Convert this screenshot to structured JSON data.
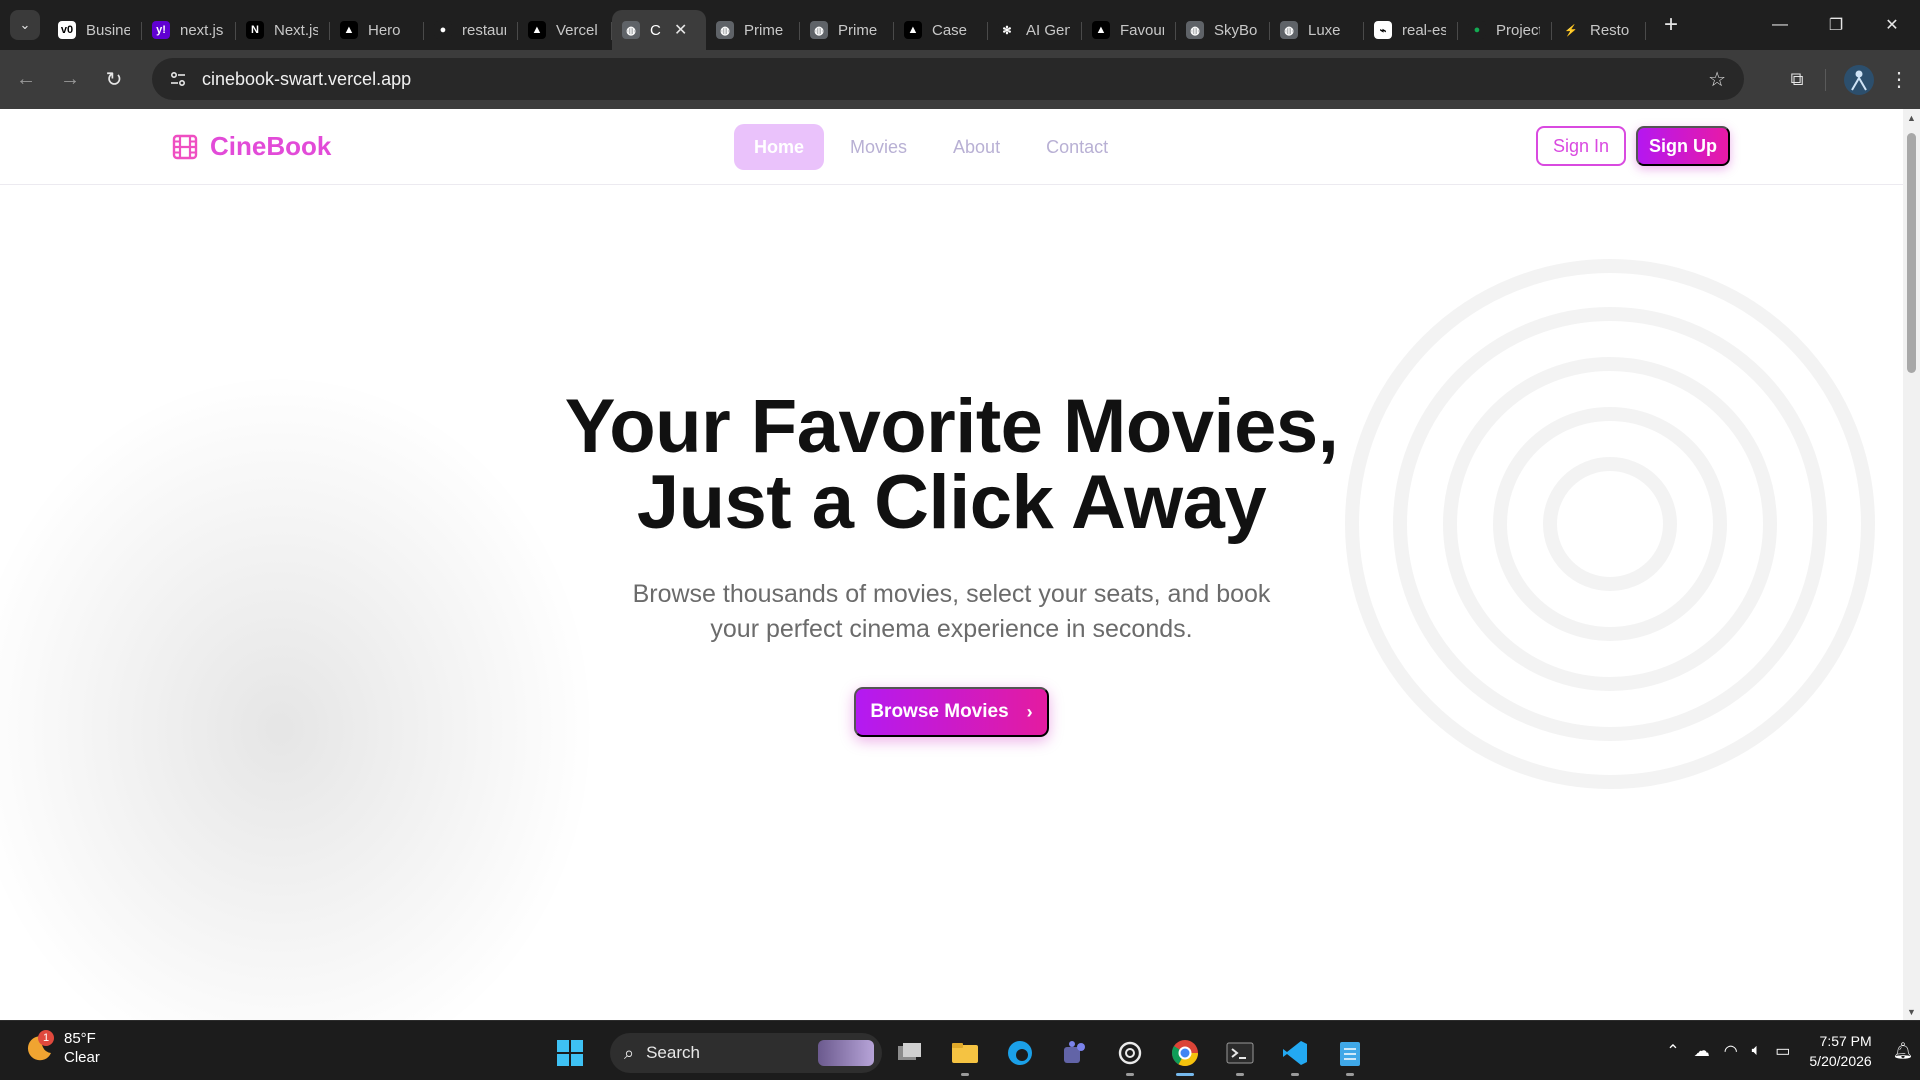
{
  "browser": {
    "tabs": [
      {
        "label": "Business",
        "color": "#ffffff",
        "glyph": "v0",
        "text_color": "#000000"
      },
      {
        "label": "next.js",
        "color": "#6001d2",
        "glyph": "y!",
        "text_color": "#ffffff"
      },
      {
        "label": "Next.js",
        "color": "#000000",
        "glyph": "N",
        "text_color": "#ffffff"
      },
      {
        "label": "Hero",
        "color": "#000000",
        "glyph": "▲",
        "text_color": "#ffffff"
      },
      {
        "label": "restaurant",
        "color": "#1f1f1f",
        "glyph": "●",
        "text_color": "#ffffff"
      },
      {
        "label": "Vercel",
        "color": "#000000",
        "glyph": "▲",
        "text_color": "#ffffff"
      },
      {
        "label": "C",
        "color": "#5f6368",
        "glyph": "◍",
        "text_color": "#ffffff",
        "active": true
      },
      {
        "label": "Prime",
        "color": "#5f6368",
        "glyph": "◍",
        "text_color": "#ffffff"
      },
      {
        "label": "Prime",
        "color": "#5f6368",
        "glyph": "◍",
        "text_color": "#ffffff"
      },
      {
        "label": "Case",
        "color": "#000000",
        "glyph": "▲",
        "text_color": "#ffffff"
      },
      {
        "label": "AI Gen",
        "color": "#1f1f1f",
        "glyph": "✻",
        "text_color": "#ffffff"
      },
      {
        "label": "Favourites",
        "color": "#000000",
        "glyph": "▲",
        "text_color": "#ffffff"
      },
      {
        "label": "SkyBook",
        "color": "#5f6368",
        "glyph": "◍",
        "text_color": "#ffffff"
      },
      {
        "label": "Luxe",
        "color": "#5f6368",
        "glyph": "◍",
        "text_color": "#ffffff"
      },
      {
        "label": "real-estate",
        "color": "#ffffff",
        "glyph": "⌁",
        "text_color": "#000000"
      },
      {
        "label": "Projects",
        "color": "#1f1f1f",
        "glyph": "●",
        "text_color": "#13aa52"
      },
      {
        "label": "Resto",
        "color": "#1f1f1f",
        "glyph": "⚡",
        "text_color": "#ffffff"
      }
    ],
    "new_tab_glyph": "+",
    "window_controls": {
      "minimize": "—",
      "restore": "❐",
      "close": "✕"
    },
    "url": "cinebook-swart.vercel.app"
  },
  "site": {
    "brand": "CineBook",
    "nav": [
      {
        "label": "Home",
        "active": true
      },
      {
        "label": "Movies"
      },
      {
        "label": "About"
      },
      {
        "label": "Contact"
      }
    ],
    "sign_in": "Sign In",
    "sign_up": "Sign Up",
    "hero": {
      "title_line1": "Your Favorite Movies,",
      "title_line2": "Just a Click Away",
      "subtitle": "Browse thousands of movies, select your seats, and book your perfect cinema experience in seconds.",
      "cta": "Browse Movies"
    },
    "colors": {
      "accent": "#d94ae0",
      "gradient_start": "#b31af2",
      "gradient_end": "#e41ba0"
    }
  },
  "taskbar": {
    "weather": {
      "temp": "85°F",
      "condition": "Clear",
      "badge": "1"
    },
    "search_label": "Search",
    "apps": [
      "task-view",
      "file-explorer",
      "edge",
      "teams",
      "chatgpt",
      "chrome",
      "terminal",
      "vscode",
      "notepad"
    ],
    "clock": {
      "time": "7:57 PM",
      "date": "5/20/2026"
    }
  }
}
